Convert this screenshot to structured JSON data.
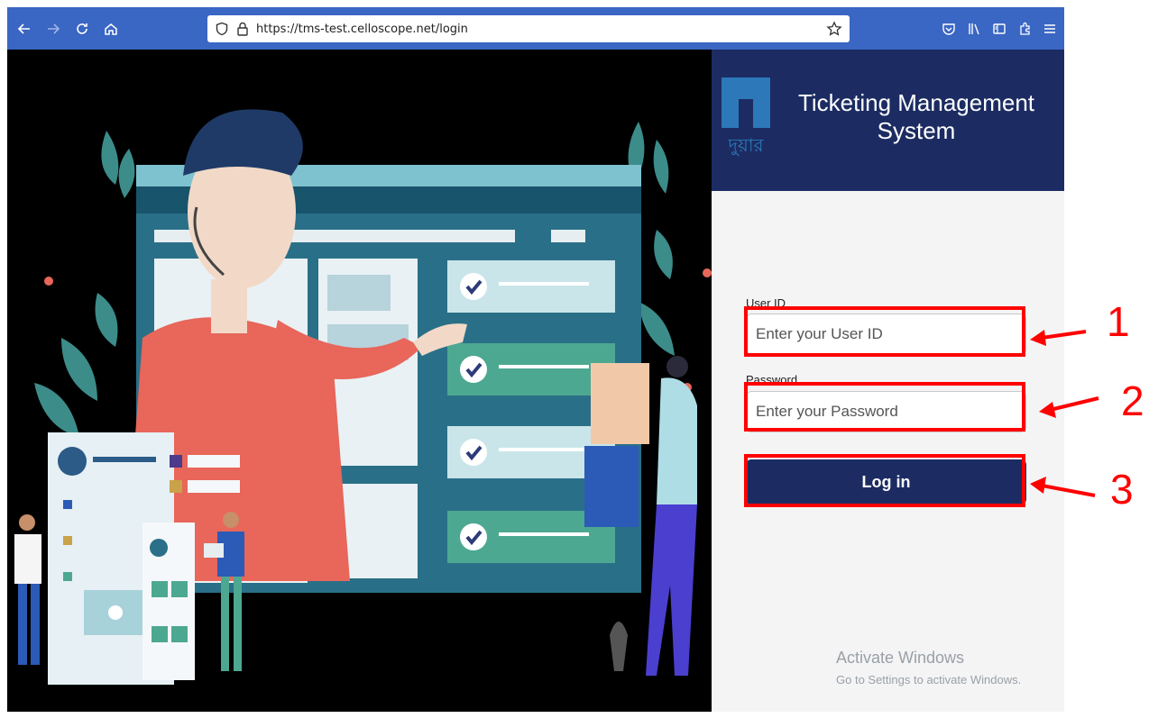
{
  "browser": {
    "url": "https://tms-test.celloscope.net/login",
    "icons": [
      "back-icon",
      "forward-icon",
      "reload-icon",
      "home-icon",
      "shield-icon",
      "lock-icon",
      "star-icon",
      "pocket-icon",
      "library-icon",
      "sidebar-icon",
      "extensions-icon",
      "menu-icon"
    ],
    "accent": "#3a66c4"
  },
  "header": {
    "logo_text": "দুয়ার",
    "title_line1": "Ticketing Management",
    "title_line2": "System",
    "color": "#1c2c62"
  },
  "form": {
    "user_label": "User ID",
    "user_placeholder": "Enter your User ID",
    "password_label": "Password",
    "password_placeholder": "Enter your Password",
    "login_label": "Log in"
  },
  "watermark": {
    "line1": "Activate Windows",
    "line2": "Go to Settings to activate Windows."
  },
  "annotations": {
    "markers": [
      "1",
      "2",
      "3"
    ],
    "color": "#ff0000"
  }
}
